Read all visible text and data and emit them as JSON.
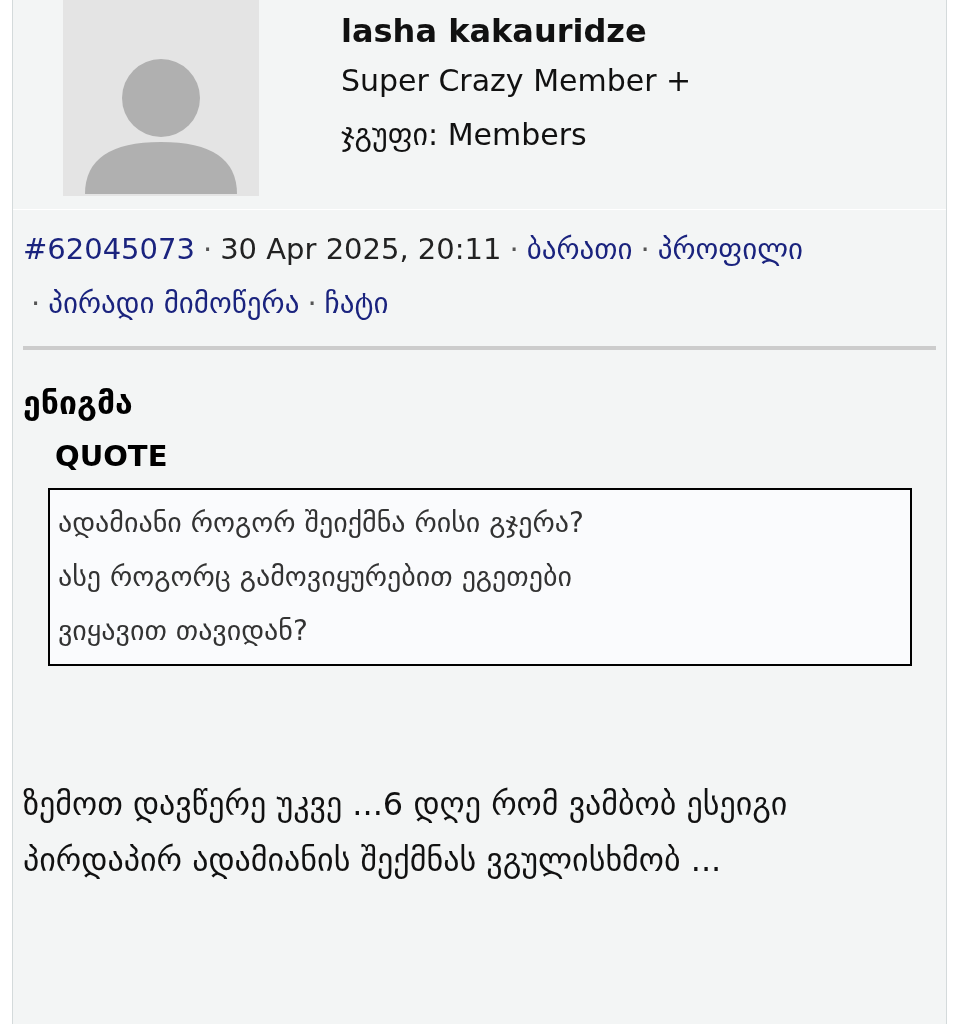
{
  "author": {
    "name": "lasha kakauridze",
    "rank": "Super Crazy Member +",
    "group_label": "ჯგუფი:",
    "group": "Members"
  },
  "meta": {
    "separator": "·",
    "items": [
      {
        "kind": "link",
        "text": "#62045073"
      },
      {
        "kind": "text",
        "text": "30 Apr 2025, 20:11"
      },
      {
        "kind": "link",
        "text": "ბარათი"
      },
      {
        "kind": "link",
        "text": "პროფილი"
      },
      {
        "kind": "link",
        "text": "პირადი მიმოწერა"
      },
      {
        "kind": "link",
        "text": "ჩატი"
      }
    ]
  },
  "post": {
    "title": "ენიგმა",
    "quote_label": "QUOTE",
    "quote_lines": [
      "ადამიანი როგორ შეიქმნა რისი გჯერა?",
      "ასე როგორც გამოვიყურებით ეგეთები",
      "ვიყავით თავიდან?"
    ],
    "body": "ზემოთ დავწერე უკვე ...6 დღე რომ ვამბობ ესეიგი პირდაპირ ადამიანის შექმნას ვგულისხმობ ..."
  }
}
